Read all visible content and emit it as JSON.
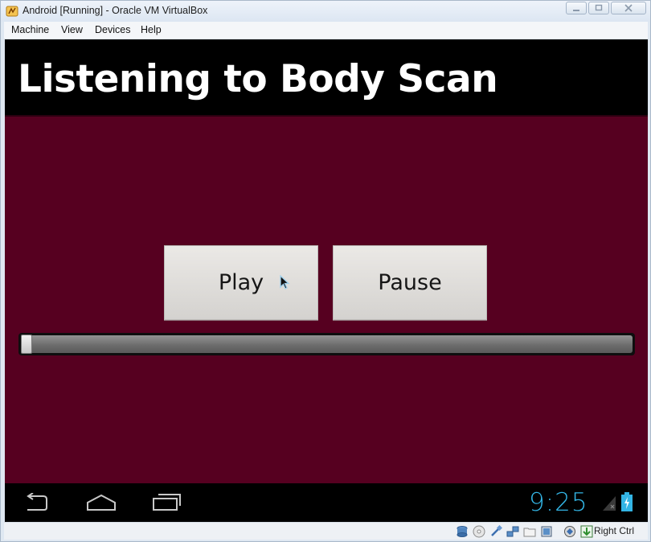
{
  "window": {
    "title": "Android [Running] - Oracle VM VirtualBox"
  },
  "menubar": {
    "items": [
      {
        "label": "Machine"
      },
      {
        "label": "View"
      },
      {
        "label": "Devices"
      },
      {
        "label": "Help"
      }
    ]
  },
  "app": {
    "title": "Listening to Body Scan",
    "play_label": "Play",
    "pause_label": "Pause",
    "seekbar_progress": 0.0
  },
  "navbar": {
    "icons": [
      "back-icon",
      "home-icon",
      "recent-apps-icon"
    ],
    "clock": "9:25"
  },
  "statusbar": {
    "icons": [
      "hard-disk-icon",
      "optical-drive-icon",
      "usb-icon",
      "network-icon",
      "shared-folders-icon",
      "video-capture-icon",
      "cpu-virtualization-icon",
      "mouse-integration-icon"
    ],
    "host_key": "Right Ctrl"
  },
  "colors": {
    "app_background": "#560020",
    "accent_blue": "#33b5e5",
    "actionbar": "#000000"
  }
}
